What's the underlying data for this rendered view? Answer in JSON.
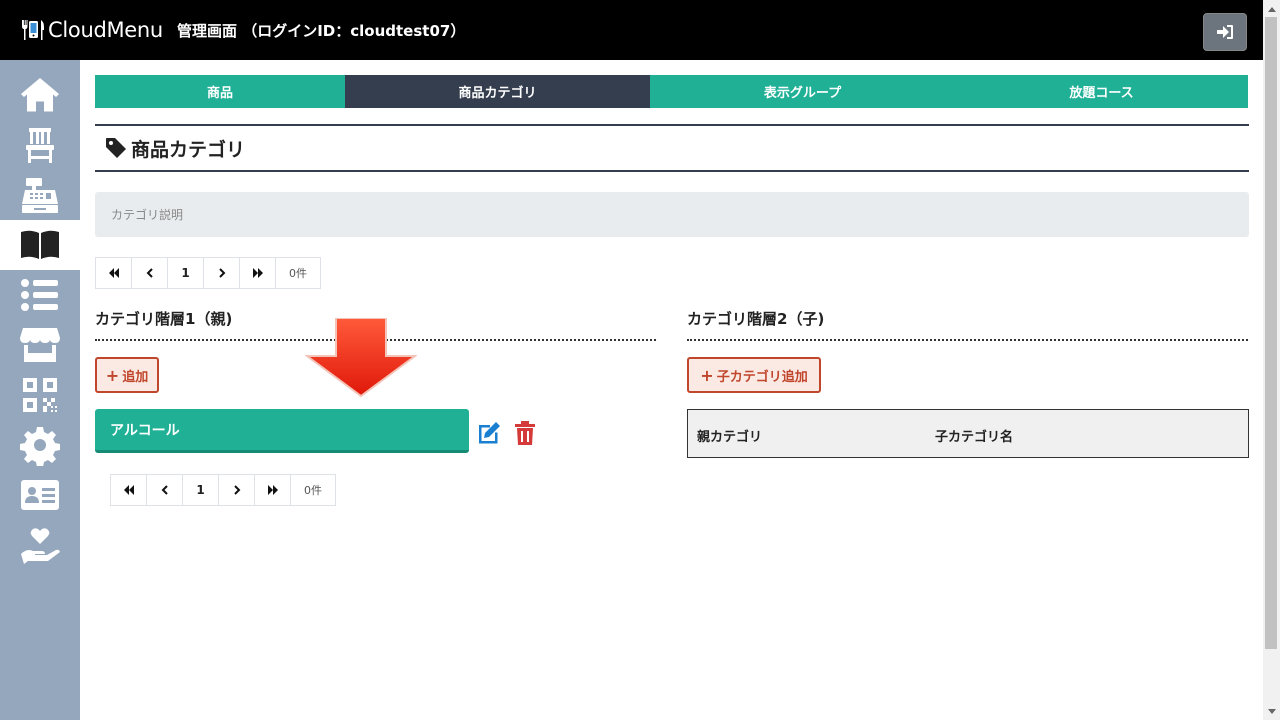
{
  "header": {
    "logo_text": "CloudMenu",
    "title": "管理画面 （ログインID：cloudtest07）",
    "logout_icon": "logout-icon"
  },
  "sidebar": {
    "items": [
      {
        "icon": "home-icon",
        "active": false
      },
      {
        "icon": "chair-icon",
        "active": false
      },
      {
        "icon": "cash-register-icon",
        "active": false
      },
      {
        "icon": "book-icon",
        "active": true
      },
      {
        "icon": "list-icon",
        "active": false
      },
      {
        "icon": "store-icon",
        "active": false
      },
      {
        "icon": "qrcode-icon",
        "active": false
      },
      {
        "icon": "gear-icon",
        "active": false
      },
      {
        "icon": "id-card-icon",
        "active": false
      },
      {
        "icon": "hand-heart-icon",
        "active": false
      }
    ]
  },
  "tabs": [
    {
      "label": "商品",
      "active": false
    },
    {
      "label": "商品カテゴリ",
      "active": true
    },
    {
      "label": "表示グループ",
      "active": false
    },
    {
      "label": "放題コース",
      "active": false
    }
  ],
  "page": {
    "title": "商品カテゴリ",
    "description_placeholder": "カテゴリ説明"
  },
  "pager_top": {
    "first": "«",
    "prev": "‹",
    "page": "1",
    "next": "›",
    "last": "»",
    "count": "0件"
  },
  "level1": {
    "heading": "カテゴリ階層1（親)",
    "add_label": "追加",
    "items": [
      {
        "name": "アルコール"
      }
    ]
  },
  "pager_bottom": {
    "first": "«",
    "prev": "‹",
    "page": "1",
    "next": "›",
    "last": "»",
    "count": "0件"
  },
  "level2": {
    "heading": "カテゴリ階層2（子)",
    "add_label": "子カテゴリ追加",
    "columns": [
      "親カテゴリ",
      "子カテゴリ名"
    ]
  },
  "colors": {
    "header_bg": "#000000",
    "sidebar_bg": "#95a7bd",
    "tab_teal": "#1fb096",
    "tab_active": "#343e4e",
    "add_red": "#c0462c",
    "arrow_red": "#e8200c"
  }
}
